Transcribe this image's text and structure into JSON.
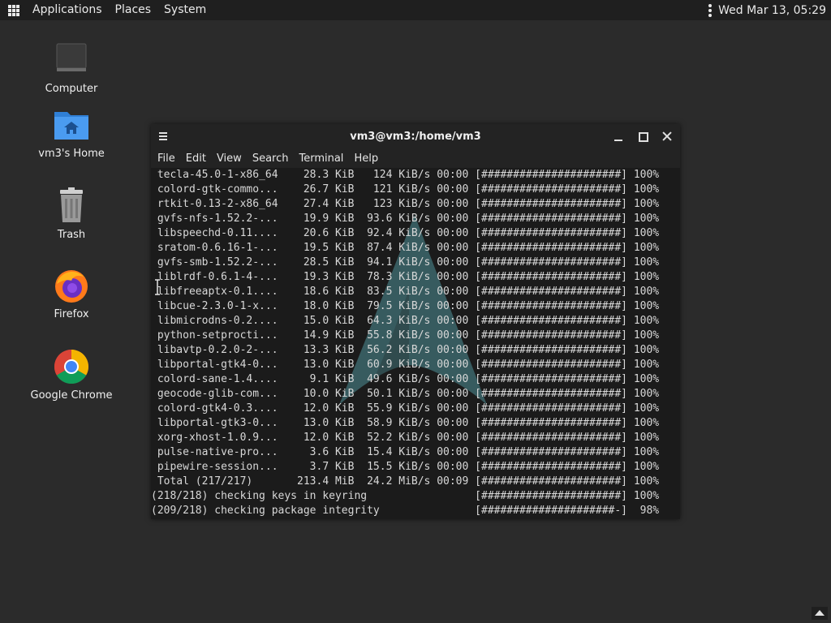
{
  "top_panel": {
    "menus": [
      "Applications",
      "Places",
      "System"
    ],
    "clock": "Wed Mar 13, 05:29"
  },
  "desktop": {
    "icons": [
      {
        "label": "Computer",
        "icon": "computer-icon"
      },
      {
        "label": "vm3's Home",
        "icon": "home-folder-icon"
      },
      {
        "label": "Trash",
        "icon": "trash-icon"
      },
      {
        "label": "Firefox",
        "icon": "firefox-icon"
      },
      {
        "label": "Google Chrome",
        "icon": "chrome-icon"
      }
    ]
  },
  "terminal": {
    "title": "vm3@vm3:/home/vm3",
    "menus": [
      "File",
      "Edit",
      "View",
      "Search",
      "Terminal",
      "Help"
    ],
    "lines": [
      " tecla-45.0-1-x86_64    28.3 KiB   124 KiB/s 00:00 [######################] 100%",
      " colord-gtk-commo...    26.7 KiB   121 KiB/s 00:00 [######################] 100%",
      " rtkit-0.13-2-x86_64    27.4 KiB   123 KiB/s 00:00 [######################] 100%",
      " gvfs-nfs-1.52.2-...    19.9 KiB  93.6 KiB/s 00:00 [######################] 100%",
      " libspeechd-0.11....    20.6 KiB  92.4 KiB/s 00:00 [######################] 100%",
      " sratom-0.6.16-1-...    19.5 KiB  87.4 KiB/s 00:00 [######################] 100%",
      " gvfs-smb-1.52.2-...    28.5 KiB  94.1 KiB/s 00:00 [######################] 100%",
      " liblrdf-0.6.1-4-...    19.3 KiB  78.3 KiB/s 00:00 [######################] 100%",
      " libfreeaptx-0.1....    18.6 KiB  83.5 KiB/s 00:00 [######################] 100%",
      " libcue-2.3.0-1-x...    18.0 KiB  79.5 KiB/s 00:00 [######################] 100%",
      " libmicrodns-0.2....    15.0 KiB  64.3 KiB/s 00:00 [######################] 100%",
      " python-setprocti...    14.9 KiB  55.8 KiB/s 00:00 [######################] 100%",
      " libavtp-0.2.0-2-...    13.3 KiB  56.2 KiB/s 00:00 [######################] 100%",
      " libportal-gtk4-0...    13.0 KiB  60.9 KiB/s 00:00 [######################] 100%",
      " colord-sane-1.4....     9.1 KiB  49.6 KiB/s 00:00 [######################] 100%",
      " geocode-glib-com...    10.0 KiB  50.1 KiB/s 00:00 [######################] 100%",
      " colord-gtk4-0.3....    12.0 KiB  55.9 KiB/s 00:00 [######################] 100%",
      " libportal-gtk3-0...    13.0 KiB  58.9 KiB/s 00:00 [######################] 100%",
      " xorg-xhost-1.0.9...    12.0 KiB  52.2 KiB/s 00:00 [######################] 100%",
      " pulse-native-pro...     3.6 KiB  15.4 KiB/s 00:00 [######################] 100%",
      " pipewire-session...     3.7 KiB  15.5 KiB/s 00:00 [######################] 100%",
      " Total (217/217)       213.4 MiB  24.2 MiB/s 00:09 [######################] 100%",
      "(218/218) checking keys in keyring                 [######################] 100%",
      "(209/218) checking package integrity               [#####################-]  98%"
    ]
  }
}
